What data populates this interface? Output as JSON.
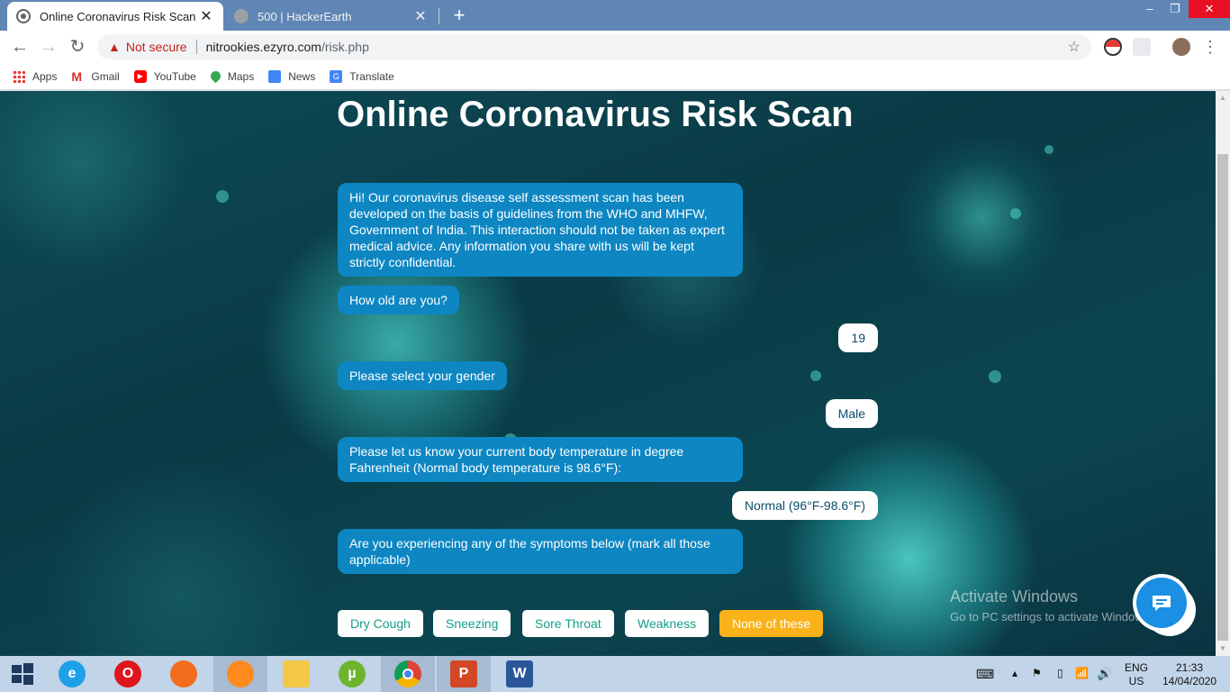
{
  "browser": {
    "tabs": [
      {
        "title": "Online Coronavirus Risk Scan",
        "close": "✕"
      },
      {
        "title": "500 | HackerEarth",
        "close": "✕"
      }
    ],
    "new_tab": "+",
    "window_controls": {
      "minimize": "–",
      "maximize": "❐",
      "close": "✕"
    },
    "security_label": "Not secure",
    "url_host": "nitrookies.ezyro.com",
    "url_path": "/risk.php",
    "bookmarks": [
      {
        "label": "Apps",
        "icon": "apps-grid-icon"
      },
      {
        "label": "Gmail",
        "icon": "gmail-icon"
      },
      {
        "label": "YouTube",
        "icon": "youtube-icon"
      },
      {
        "label": "Maps",
        "icon": "maps-pin-icon"
      },
      {
        "label": "News",
        "icon": "news-icon"
      },
      {
        "label": "Translate",
        "icon": "translate-icon"
      }
    ]
  },
  "page": {
    "title": "Online Coronavirus Risk Scan",
    "messages": [
      {
        "from": "bot",
        "text": "Hi! Our coronavirus disease self assessment scan has been developed on the basis of guidelines from the WHO and MHFW, Government of India. This interaction should not be taken as expert medical advice. Any information you share with us will be kept strictly confidential."
      },
      {
        "from": "bot",
        "text": "How old are you?"
      },
      {
        "from": "user",
        "text": "19"
      },
      {
        "from": "bot",
        "text": "Please select your gender"
      },
      {
        "from": "user",
        "text": "Male"
      },
      {
        "from": "bot",
        "text": "Please let us know your current body temperature in degree Fahrenheit (Normal body temperature is 98.6°F):"
      },
      {
        "from": "user",
        "text": "Normal (96°F-98.6°F)"
      },
      {
        "from": "bot",
        "text": "Are you experiencing any of the symptoms below (mark all those applicable)"
      }
    ],
    "options": [
      {
        "label": "Dry Cough",
        "selected": false
      },
      {
        "label": "Sneezing",
        "selected": false
      },
      {
        "label": "Sore Throat",
        "selected": false
      },
      {
        "label": "Weakness",
        "selected": false
      },
      {
        "label": "None of these",
        "selected": true
      }
    ],
    "watermark": {
      "title": "Activate Windows",
      "subtitle": "Go to PC settings to activate Windows."
    }
  },
  "taskbar": {
    "apps": [
      "internet-explorer-icon",
      "opera-icon",
      "firefox-developer-icon",
      "firefox-icon",
      "file-explorer-icon",
      "utorrent-icon",
      "chrome-icon",
      "powerpoint-icon",
      "word-icon"
    ],
    "language": "ENG",
    "region": "US",
    "time": "21:33",
    "date": "14/04/2020"
  },
  "colors": {
    "bot_bubble": "#0d86c2",
    "option_selected": "#f9b21a",
    "option_text": "#16a085",
    "chat_button": "#1a8fe3"
  }
}
